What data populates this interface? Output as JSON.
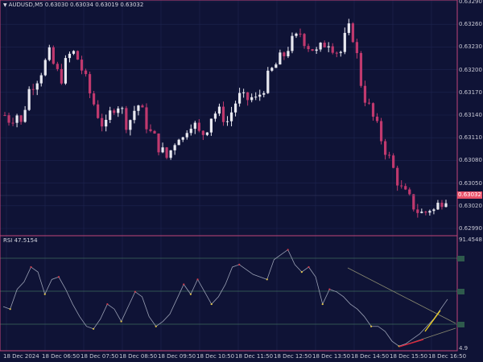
{
  "colors": {
    "background": "#0f1336",
    "grid": "#1e2450",
    "frame": "#c0447a",
    "bull": "#e8e8f0",
    "bear": "#c0396e",
    "rsi_line": "#9aa0b4",
    "level": "#3f6a5c",
    "accent": "#e8526a",
    "dot_up": "#e0c44a",
    "dot_down": "#d04050",
    "trend_yellow": "#f2d21e",
    "trend_red": "#e0203a",
    "trend_gray": "#8a8a70"
  },
  "header": {
    "menu_icon": "triangle-down-icon",
    "symbol": "AUDUSD,M5",
    "ohlc": "0.63030 0.63034 0.63019 0.63032"
  },
  "price_axis": {
    "ticks": [
      "0.63290",
      "0.63260",
      "0.63230",
      "0.63200",
      "0.63170",
      "0.63140",
      "0.63110",
      "0.63080",
      "0.63050",
      "0.63020",
      "0.62990"
    ],
    "current_price": "0.63032"
  },
  "rsi_panel": {
    "title": "RSI 47.5154",
    "ticks": [
      "91.4548",
      "4.9"
    ]
  },
  "time_axis": {
    "labels": [
      "18 Dec 2024",
      "18 Dec 06:50",
      "18 Dec 07:50",
      "18 Dec 08:50",
      "18 Dec 09:50",
      "18 Dec 10:50",
      "18 Dec 11:50",
      "18 Dec 12:50",
      "18 Dec 13:50",
      "18 Dec 14:50",
      "18 Dec 15:50",
      "18 Dec 16:50"
    ]
  },
  "chart_data": [
    {
      "type": "candlestick",
      "title": "AUDUSD,M5",
      "ylim": [
        0.6298,
        0.633
      ],
      "close_path": [
        0.63145,
        0.63138,
        0.6315,
        0.6313,
        0.63175,
        0.6319,
        0.632,
        0.63215,
        0.6323,
        0.6321,
        0.63195,
        0.6322,
        0.63235,
        0.63225,
        0.63205,
        0.6318,
        0.6316,
        0.6314,
        0.63125,
        0.6315,
        0.63165,
        0.6315,
        0.6313,
        0.6315,
        0.6316,
        0.6314,
        0.6312,
        0.6311,
        0.63095,
        0.63085,
        0.631,
        0.6312,
        0.6311,
        0.6314,
        0.6313,
        0.63115,
        0.63125,
        0.63145,
        0.6315,
        0.63145,
        0.63135,
        0.6316,
        0.6317,
        0.63165,
        0.6317,
        0.63165,
        0.6318,
        0.63195,
        0.6321,
        0.6322,
        0.6323,
        0.63245,
        0.6325,
        0.63262,
        0.63245,
        0.6324,
        0.6323,
        0.63245,
        0.6325,
        0.6324,
        0.6323,
        0.63255,
        0.6327,
        0.6323,
        0.6318,
        0.6316,
        0.6314,
        0.6312,
        0.631,
        0.6308,
        0.6306,
        0.6304,
        0.6303,
        0.6302,
        0.6301,
        0.63005,
        0.63015,
        0.6301,
        0.63025,
        0.63032
      ]
    },
    {
      "type": "line",
      "title": "RSI 47.5154",
      "ylim": [
        4.9,
        91.4548
      ],
      "values": [
        38,
        36,
        52,
        58,
        70,
        66,
        48,
        60,
        62,
        52,
        40,
        30,
        22,
        20,
        28,
        40,
        36,
        26,
        38,
        50,
        46,
        30,
        22,
        26,
        32,
        44,
        56,
        48,
        60,
        50,
        40,
        46,
        56,
        70,
        72,
        68,
        64,
        62,
        60,
        76,
        80,
        84,
        72,
        66,
        70,
        62,
        40,
        52,
        50,
        46,
        40,
        36,
        30,
        22,
        22,
        18,
        10,
        6,
        8,
        12,
        16,
        22,
        28,
        36,
        44
      ]
    }
  ]
}
